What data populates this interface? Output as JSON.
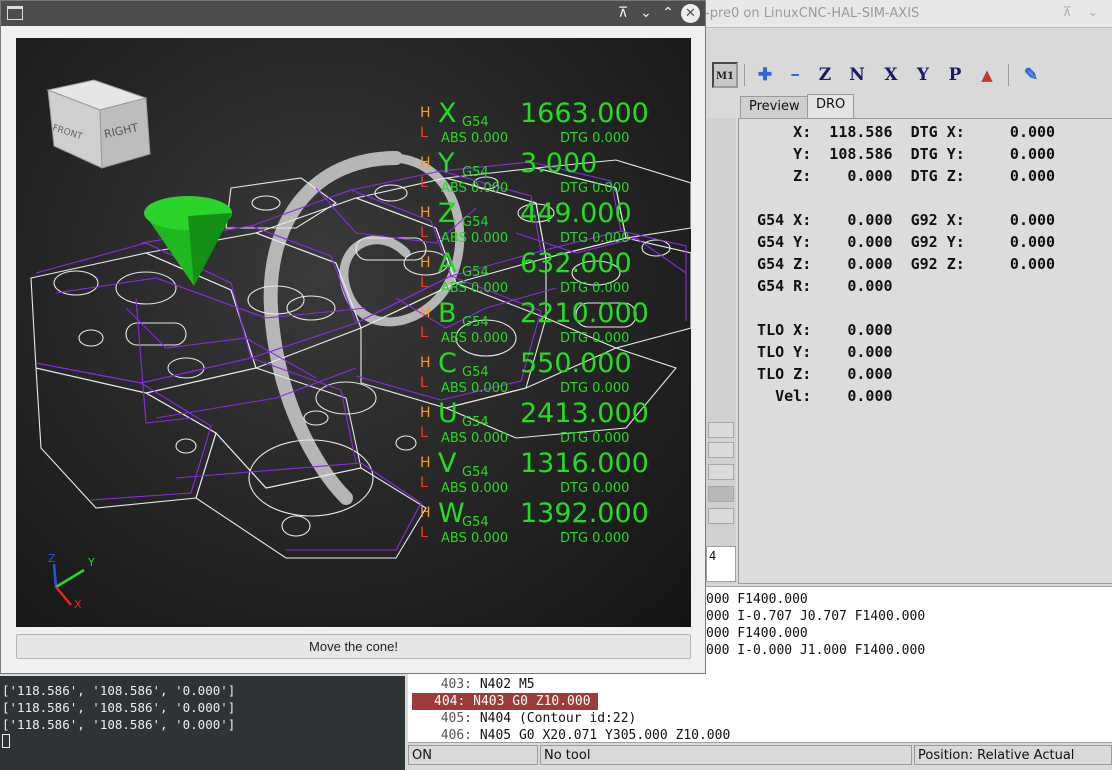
{
  "axis_window": {
    "title": "-pre0 on LinuxCNC-HAL-SIM-AXIS",
    "tabs": [
      {
        "label": "Preview"
      },
      {
        "label": "DRO"
      }
    ],
    "toolbar": {
      "buttons": [
        {
          "name": "mist-toggle-icon",
          "glyph": "M1"
        },
        {
          "name": "zoom-in-icon",
          "glyph": "✚"
        },
        {
          "name": "zoom-out-icon",
          "glyph": "━"
        },
        {
          "name": "view-z-icon",
          "glyph": "Z"
        },
        {
          "name": "view-z2-icon",
          "glyph": "N"
        },
        {
          "name": "view-x-icon",
          "glyph": "X"
        },
        {
          "name": "view-y-icon",
          "glyph": "Y"
        },
        {
          "name": "view-p-icon",
          "glyph": "P"
        },
        {
          "name": "rotate-icon",
          "glyph": "▲"
        },
        {
          "name": "clear-plot-icon",
          "glyph": "✎"
        }
      ]
    },
    "dro_lines": [
      "      X:  118.586  DTG X:     0.000",
      "      Y:  108.586  DTG Y:     0.000",
      "      Z:    0.000  DTG Z:     0.000",
      "",
      "  G54 X:    0.000  G92 X:     0.000",
      "  G54 Y:    0.000  G92 Y:     0.000",
      "  G54 Z:    0.000  G92 Z:     0.000",
      "  G54 R:    0.000",
      "",
      "  TLO X:    0.000",
      "  TLO Y:    0.000",
      "  TLO Z:    0.000",
      "    Vel:    0.000"
    ],
    "mdi_text": "4",
    "gcode_lines": [
      {
        "num": "",
        "code": "000 F1400.000"
      },
      {
        "num": "",
        "code": "000 I-0.707 J0.707 F1400.000"
      },
      {
        "num": "",
        "code": "000 F1400.000"
      },
      {
        "num": "",
        "code": "000 I-0.000 J1.000 F1400.000"
      },
      {
        "num": "403:",
        "code": "N402 M5"
      },
      {
        "num": "404:",
        "code": "N403 G0 Z10.000",
        "highlight": true
      },
      {
        "num": "405:",
        "code": "N404 (Contour id:22)"
      },
      {
        "num": "406:",
        "code": "N405 G0 X20.071 Y305.000 Z10.000"
      }
    ],
    "status": {
      "state": "ON",
      "tool": "No tool",
      "position": "Position: Relative Actual"
    }
  },
  "console": {
    "lines": [
      "['118.586', '108.586', '0.000']",
      "['118.586', '108.586', '0.000']",
      "['118.586', '108.586', '0.000']"
    ]
  },
  "viewer_window": {
    "button_label": "Move the cone!",
    "view_cube": {
      "front_label": "FRONT",
      "right_label": "RIGHT"
    },
    "axis_triad": {
      "z": "Z",
      "y": "Y",
      "x": "X"
    },
    "dro_overlay": [
      {
        "h": "H",
        "l": "L",
        "axis": "X",
        "wcs": "G54",
        "value": "1663.000",
        "abs": "ABS 0.000",
        "dtg": "DTG 0.000"
      },
      {
        "h": "H",
        "l": "L",
        "axis": "Y",
        "wcs": "G54",
        "value": "3.000",
        "abs": "ABS 0.000",
        "dtg": "DTG 0.000"
      },
      {
        "h": "H",
        "l": "L",
        "axis": "Z",
        "wcs": "G54",
        "value": "449.000",
        "abs": "ABS 0.000",
        "dtg": "DTG 0.000"
      },
      {
        "h": "H",
        "l": "L",
        "axis": "A",
        "wcs": "G54",
        "value": "632.000",
        "abs": "ABS 0.000",
        "dtg": "DTG 0.000"
      },
      {
        "h": "H",
        "l": "L",
        "axis": "B",
        "wcs": "G54",
        "value": "2210.000",
        "abs": "ABS 0.000",
        "dtg": "DTG 0.000"
      },
      {
        "h": "H",
        "l": "L",
        "axis": "C",
        "wcs": "G54",
        "value": "550.000",
        "abs": "ABS 0.000",
        "dtg": "DTG 0.000"
      },
      {
        "h": "H",
        "l": "L",
        "axis": "U",
        "wcs": "G54",
        "value": "2413.000",
        "abs": "ABS 0.000",
        "dtg": "DTG 0.000"
      },
      {
        "h": "H",
        "l": "L",
        "axis": "V",
        "wcs": "G54",
        "value": "1316.000",
        "abs": "ABS 0.000",
        "dtg": "DTG 0.000"
      },
      {
        "h": "H",
        "l": "L",
        "axis": "W",
        "wcs": "G54",
        "value": "1392.000",
        "abs": "ABS 0.000",
        "dtg": "DTG 0.000"
      }
    ],
    "colors": {
      "dro_green": "#22dd22",
      "home_orange": "#ff9a1a",
      "limit_red": "#ff3b1a",
      "cone_green": "#1fb81f",
      "toolpath_purple": "#8a2be2"
    }
  }
}
